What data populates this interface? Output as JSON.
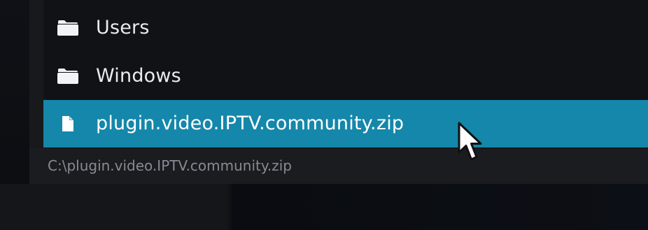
{
  "file_browser": {
    "items": [
      {
        "label": "Users",
        "icon": "folder-icon",
        "selected": false
      },
      {
        "label": "Windows",
        "icon": "folder-icon",
        "selected": false
      },
      {
        "label": "plugin.video.IPTV.community.zip",
        "icon": "file-icon",
        "selected": true
      }
    ],
    "current_path": "C:\\plugin.video.IPTV.community.zip"
  },
  "colors": {
    "selection": "#1487aa",
    "list_background": "#101216",
    "panel_background": "#17191d",
    "text": "#e9ebee",
    "path_text": "#868b93"
  },
  "cursor": {
    "icon": "mouse-pointer-icon"
  }
}
